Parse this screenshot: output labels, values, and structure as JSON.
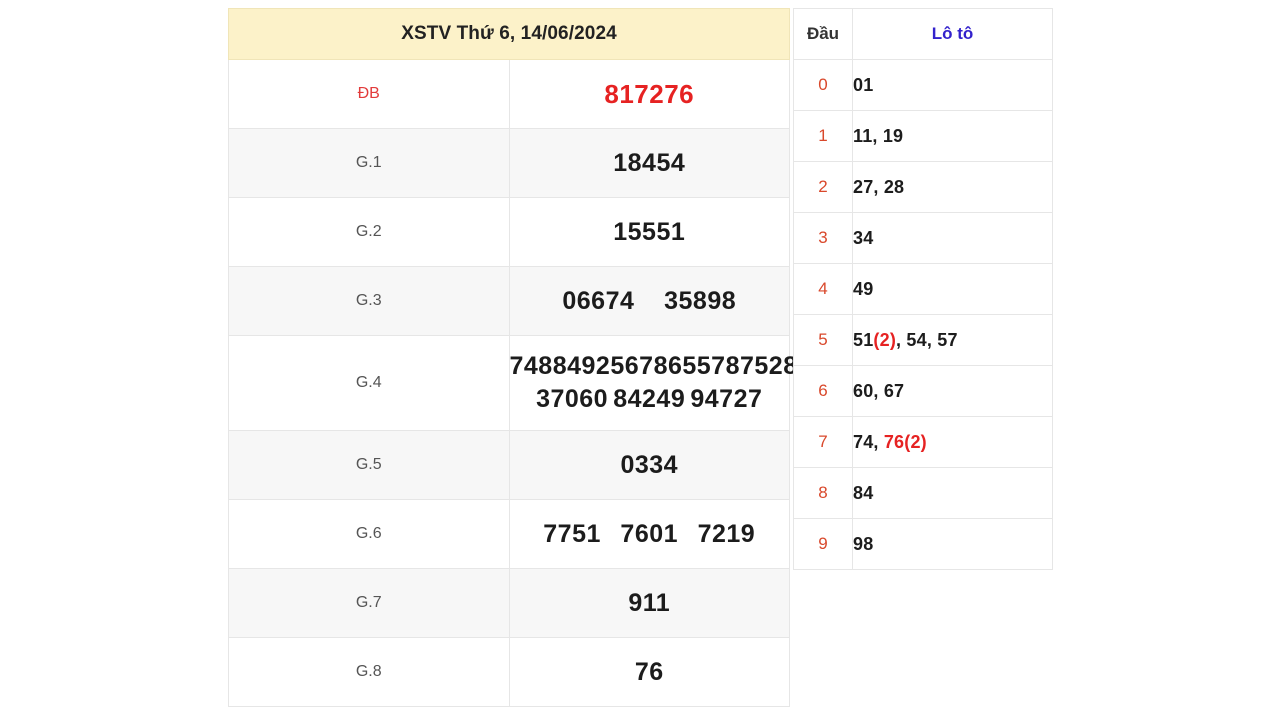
{
  "page": {
    "background": "#ffffff",
    "header_background": "#fcf2c9",
    "accent_red": "#e62222",
    "accent_blue": "#3322cc",
    "dau_digit_color": "#d9482b"
  },
  "results": {
    "title": "XSTV Thứ 6, 14/06/2024",
    "rows": [
      {
        "label": "ĐB",
        "numbers": [
          "817276"
        ]
      },
      {
        "label": "G.1",
        "numbers": [
          "18454"
        ]
      },
      {
        "label": "G.2",
        "numbers": [
          "15551"
        ]
      },
      {
        "label": "G.3",
        "numbers": [
          "06674",
          "35898"
        ]
      },
      {
        "label": "G.4",
        "numbers": [
          "74884",
          "92567",
          "86557",
          "87528",
          "37060",
          "84249",
          "94727"
        ]
      },
      {
        "label": "G.5",
        "numbers": [
          "0334"
        ]
      },
      {
        "label": "G.6",
        "numbers": [
          "7751",
          "7601",
          "7219"
        ]
      },
      {
        "label": "G.7",
        "numbers": [
          "911"
        ]
      },
      {
        "label": "G.8",
        "numbers": [
          "76"
        ]
      }
    ],
    "cells": {
      "db_label": "ĐB",
      "db_number": "817276",
      "g1_label": "G.1",
      "g1_number": "18454",
      "g2_label": "G.2",
      "g2_number": "15551",
      "g3_label": "G.3",
      "g3_n1": "06674",
      "g3_n2": "35898",
      "g4_label": "G.4",
      "g4_n1": "74884",
      "g4_n2": "92567",
      "g4_n3": "86557",
      "g4_n4": "87528",
      "g4_n5": "37060",
      "g4_n6": "84249",
      "g4_n7": "94727",
      "g5_label": "G.5",
      "g5_number": "0334",
      "g6_label": "G.6",
      "g6_n1": "7751",
      "g6_n2": "7601",
      "g6_n3": "7219",
      "g7_label": "G.7",
      "g7_number": "911",
      "g8_label": "G.8",
      "g8_number": "76"
    }
  },
  "loto": {
    "header": {
      "dau": "Đầu",
      "loto": "Lô tô"
    },
    "rows": [
      {
        "dau": "0",
        "plain": "01",
        "parts": [
          {
            "t": "01",
            "hot": false
          }
        ]
      },
      {
        "dau": "1",
        "plain": "11, 19",
        "parts": [
          {
            "t": "11, 19",
            "hot": false
          }
        ]
      },
      {
        "dau": "2",
        "plain": "27, 28",
        "parts": [
          {
            "t": "27, 28",
            "hot": false
          }
        ]
      },
      {
        "dau": "3",
        "plain": "34",
        "parts": [
          {
            "t": "34",
            "hot": false
          }
        ]
      },
      {
        "dau": "4",
        "plain": "49",
        "parts": [
          {
            "t": "49",
            "hot": false
          }
        ]
      },
      {
        "dau": "5",
        "plain": "51(2), 54, 57",
        "parts": [
          {
            "t": "51",
            "hot": false
          },
          {
            "t": "(2)",
            "hot": true
          },
          {
            "t": ", 54, 57",
            "hot": false
          }
        ]
      },
      {
        "dau": "6",
        "plain": "60, 67",
        "parts": [
          {
            "t": "60, 67",
            "hot": false
          }
        ]
      },
      {
        "dau": "7",
        "plain": "74, 76(2)",
        "parts": [
          {
            "t": "74, ",
            "hot": false
          },
          {
            "t": "76(2)",
            "hot": true
          }
        ]
      },
      {
        "dau": "8",
        "plain": "84",
        "parts": [
          {
            "t": "84",
            "hot": false
          }
        ]
      },
      {
        "dau": "9",
        "plain": "98",
        "parts": [
          {
            "t": "98",
            "hot": false
          }
        ]
      }
    ],
    "cells": {
      "r0_dau": "0",
      "r1_dau": "1",
      "r2_dau": "2",
      "r3_dau": "3",
      "r4_dau": "4",
      "r5_dau": "5",
      "r6_dau": "6",
      "r7_dau": "7",
      "r8_dau": "8",
      "r9_dau": "9",
      "r0_v": "01",
      "r1_v": "11, 19",
      "r2_v": "27, 28",
      "r3_v": "34",
      "r4_v": "49",
      "r5_a": "51",
      "r5_b": "(2)",
      "r5_c": ", 54, 57",
      "r6_v": "60, 67",
      "r7_a": "74, ",
      "r7_b": "76(2)",
      "r8_v": "84",
      "r9_v": "98"
    }
  }
}
